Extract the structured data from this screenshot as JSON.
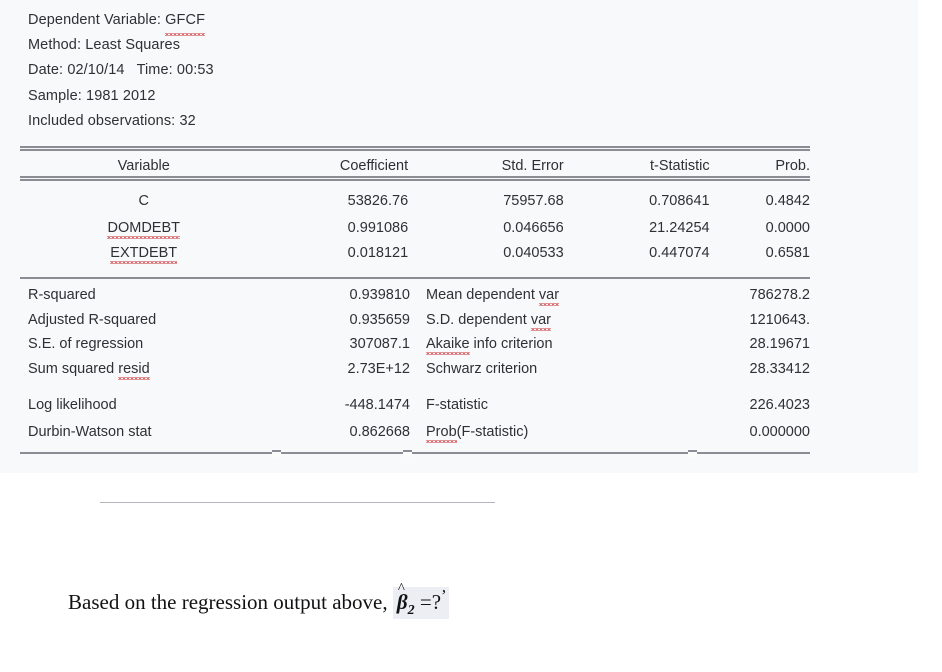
{
  "document": {
    "type": "eviews-regression-output",
    "background_color": "#f8f9fb",
    "text_color": "#2e3033",
    "squiggle_color": "#d2565a"
  },
  "header": {
    "dependent_variable_label": "Dependent Variable:",
    "dependent_variable_value": "GFCF",
    "method_label": "Method:",
    "method_value": "Least Squares",
    "date_label": "Date:",
    "date_value": "02/10/14",
    "time_label": "Time:",
    "time_value": "00:53",
    "sample_label": "Sample:",
    "sample_value": "1981 2012",
    "observations_label": "Included observations:",
    "observations_value": "32"
  },
  "coefficient_table": {
    "columns": [
      "Variable",
      "Coefficient",
      "Std. Error",
      "t-Statistic",
      "Prob."
    ],
    "rows": [
      {
        "variable": "C",
        "misspelled": false,
        "coefficient": "53826.76",
        "std_error": "75957.68",
        "t_statistic": "0.708641",
        "prob": "0.4842"
      },
      {
        "variable": "DOMDEBT",
        "misspelled": true,
        "coefficient": "0.991086",
        "std_error": "0.046656",
        "t_statistic": "21.24254",
        "prob": "0.0000"
      },
      {
        "variable": "EXTDEBT",
        "misspelled": true,
        "coefficient": "0.018121",
        "std_error": "0.040533",
        "t_statistic": "0.447074",
        "prob": "0.6581"
      }
    ]
  },
  "statistics": {
    "rows": [
      {
        "left_label": "R-squared",
        "left_value": "0.939810",
        "right_label_pre": "Mean dependent ",
        "right_label_flag": "var",
        "right_label_post": "",
        "right_value": "786278.2",
        "gap_before": false
      },
      {
        "left_label": "Adjusted R-squared",
        "left_value": "0.935659",
        "right_label_pre": "S.D. dependent ",
        "right_label_flag": "var",
        "right_label_post": "",
        "right_value": "1210643.",
        "gap_before": false
      },
      {
        "left_label": "S.E. of regression",
        "left_value": "307087.1",
        "right_label_pre": "",
        "right_label_flag": "Akaike",
        "right_label_post": " info criterion",
        "right_value": "28.19671",
        "gap_before": false
      },
      {
        "left_label_pre": "Sum squared ",
        "left_label_flag": "resid",
        "left_label": "Sum squared resid",
        "left_value": "2.73E+12",
        "right_label_pre": "Schwarz criterion",
        "right_label_flag": "",
        "right_label_post": "",
        "right_value": "28.33412",
        "gap_before": false
      },
      {
        "left_label": "Log likelihood",
        "left_value": "-448.1474",
        "right_label_pre": "F-statistic",
        "right_label_flag": "",
        "right_label_post": "",
        "right_value": "226.4023",
        "gap_before": true
      },
      {
        "left_label": "Durbin-Watson stat",
        "left_value": "0.862668",
        "right_label_pre": "",
        "right_label_flag": "Prob",
        "right_label_post": "(F-statistic)",
        "right_value": "0.000000",
        "gap_before": false
      }
    ]
  },
  "question": {
    "text": "Based on the regression output above,",
    "symbol_beta": "β",
    "symbol_hat": "^",
    "symbol_subscript": "2",
    "symbol_equals": " =?",
    "symbol_prime": "’",
    "highlight_color": "#eceef3"
  }
}
